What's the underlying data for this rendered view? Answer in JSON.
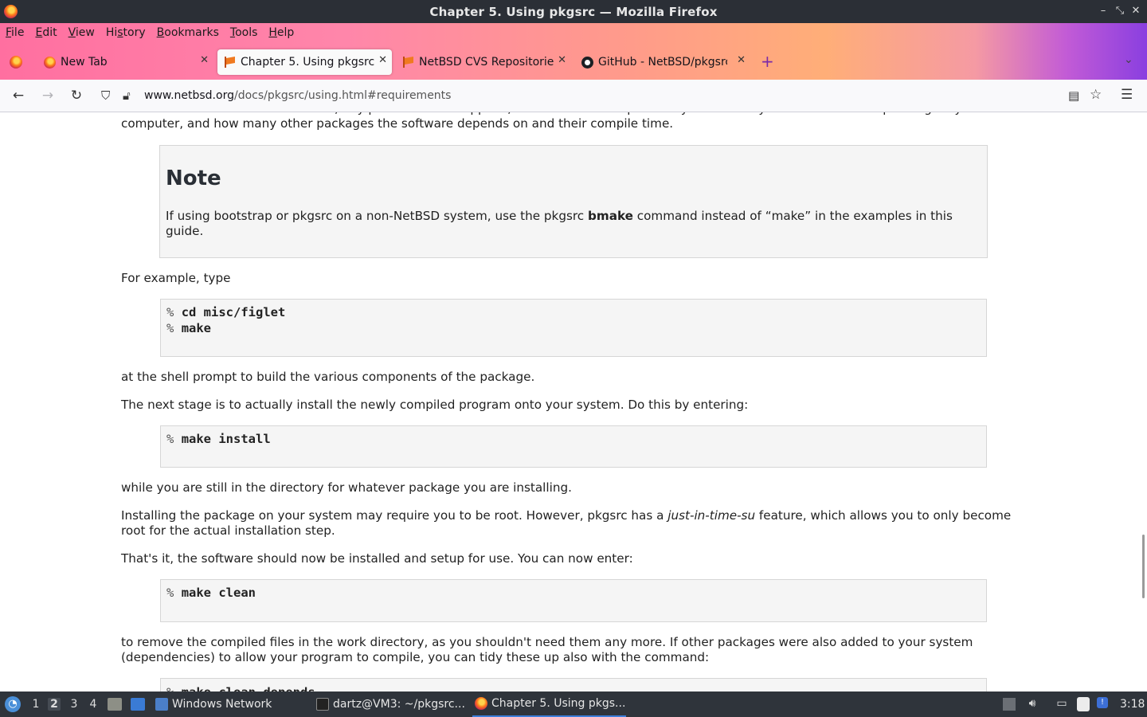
{
  "window": {
    "title": "Chapter 5. Using pkgsrc — Mozilla Firefox"
  },
  "menubar": {
    "items": [
      {
        "accel": "F",
        "rest": "ile"
      },
      {
        "accel": "E",
        "rest": "dit"
      },
      {
        "accel": "V",
        "rest": "iew"
      },
      {
        "accel": "",
        "pre": "Hi",
        "accel2": "s",
        "rest": "tory"
      },
      {
        "accel": "B",
        "rest": "ookmarks"
      },
      {
        "accel": "T",
        "rest": "ools"
      },
      {
        "accel": "H",
        "rest": "elp"
      }
    ]
  },
  "tabs": [
    {
      "label": "New Tab",
      "icon": "firefox-icon",
      "active": false
    },
    {
      "label": "Chapter 5. Using pkgsrc",
      "icon": "netbsd-flag-icon",
      "active": true
    },
    {
      "label": "NetBSD CVS Repositories",
      "icon": "netbsd-flag-icon",
      "active": false
    },
    {
      "label": "GitHub - NetBSD/pkgsrc:",
      "icon": "github-icon",
      "active": false
    }
  ],
  "navbar": {
    "url_host": "www.netbsd.org",
    "url_path": "/docs/pkgsrc/using.html#requirements"
  },
  "content": {
    "p_top": "Once the software has downloaded, any patches will be applied, then it will be compiled for you. This may take some time depending on your computer, and how many other packages the software depends on and their compile time.",
    "note_title": "Note",
    "note_before": "If using bootstrap or pkgsrc on a non-NetBSD system, use the pkgsrc ",
    "note_bold": "bmake",
    "note_after": " command instead of “make” in the examples in this guide.",
    "p_example": "For example, type",
    "code1_prompt": "%",
    "code1_line1": "cd misc/figlet",
    "code1_line2": "make",
    "p_shell": "at the shell prompt to build the various components of the package.",
    "p_next": "The next stage is to actually install the newly compiled program onto your system. Do this by entering:",
    "code2": "make install",
    "p_while": "while you are still in the directory for whatever package you are installing.",
    "p_root_before": "Installing the package on your system may require you to be root. However, pkgsrc has a ",
    "p_root_em": "just-in-time-su",
    "p_root_after": " feature, which allows you to only become root for the actual installation step.",
    "p_thats": "That's it, the software should now be installed and setup for use. You can now enter:",
    "code3": "make clean",
    "p_remove": "to remove the compiled files in the work directory, as you shouldn't need them any more. If other packages were also added to your system (dependencies) to allow your program to compile, you can tidy these up also with the command:",
    "code4": "make clean-depends"
  },
  "taskbar": {
    "workspaces": [
      "1",
      "2",
      "3",
      "4"
    ],
    "active_workspace": "2",
    "windows": [
      {
        "label": "Windows Network",
        "icon": "folder-icon"
      },
      {
        "label": "dartz@VM3: ~/pkgsrc...",
        "icon": "terminal-icon"
      },
      {
        "label": "Chapter 5. Using pkgs...",
        "icon": "firefox-icon"
      }
    ],
    "clock": "3:18"
  },
  "colors": {
    "titlebar": "#2b2f36",
    "taskbar": "#2f343b",
    "accent": "#3d7edb"
  }
}
